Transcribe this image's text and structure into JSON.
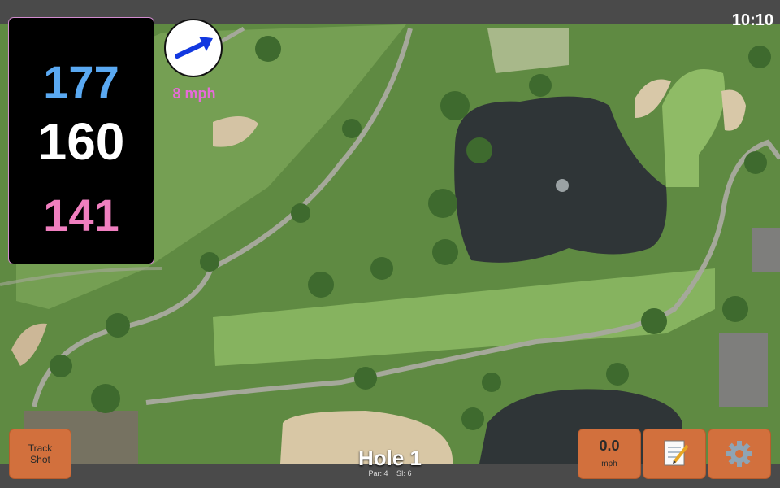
{
  "status": {
    "clock": "10:10"
  },
  "distances": {
    "back": "177",
    "middle": "160",
    "front": "141"
  },
  "wind": {
    "speed": "8 mph",
    "icon": "wind-arrow-icon"
  },
  "buttons": {
    "track_shot_line1": "Track",
    "track_shot_line2": "Shot",
    "speed_value": "0.0",
    "speed_unit": "mph",
    "notes_icon": "notepad-icon",
    "settings_icon": "gear-icon"
  },
  "hole": {
    "title": "Hole 1",
    "par": "Par: 4",
    "si": "SI: 6"
  },
  "colors": {
    "back": "#5aa9f2",
    "front": "#f07fbf",
    "wind": "#e66bd9",
    "button": "#d2703d"
  }
}
